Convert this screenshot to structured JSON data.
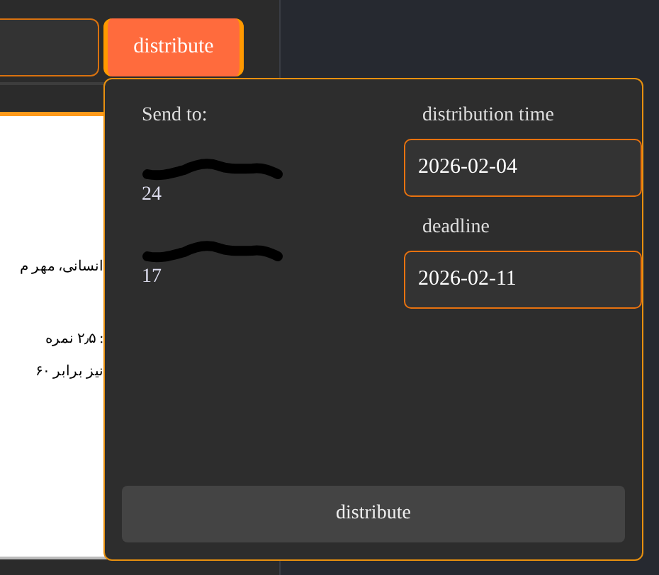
{
  "toolbar": {
    "distribute_button": "distribute"
  },
  "document": {
    "lines": [
      "انسانی، مهر م",
      ": ۲٫۵ نمره",
      "نیز برابر ۶۰"
    ]
  },
  "popup": {
    "send_to_label": "Send to:",
    "recipients": [
      {
        "count": "24"
      },
      {
        "count": "17"
      }
    ],
    "fields": [
      {
        "label": "distribution time",
        "value": "2026-02-04"
      },
      {
        "label": "deadline",
        "value": "2026-02-11"
      }
    ],
    "submit": "distribute"
  }
}
